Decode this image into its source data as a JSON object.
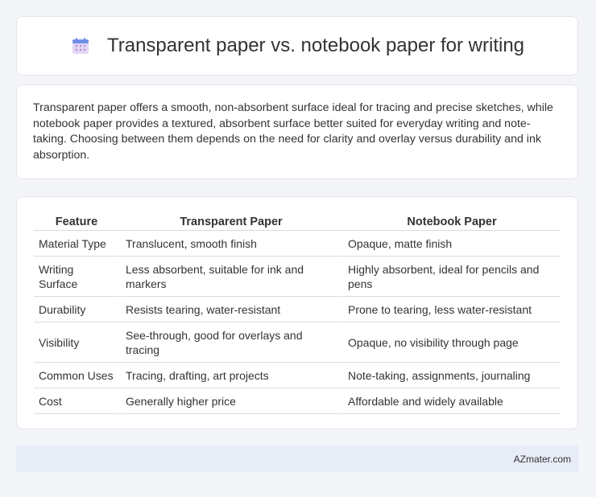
{
  "header": {
    "title": "Transparent paper vs. notebook paper for writing",
    "icon": "calendar-icon",
    "icon_colors": {
      "top": "#6f8fe6",
      "body": "#e3d6f3",
      "dots": "#a98bd8"
    }
  },
  "intro": {
    "text": "Transparent paper offers a smooth, non-absorbent surface ideal for tracing and precise sketches, while notebook paper provides a textured, absorbent surface better suited for everyday writing and note-taking. Choosing between them depends on the need for clarity and overlay versus durability and ink absorption."
  },
  "table": {
    "headers": [
      "Feature",
      "Transparent Paper",
      "Notebook Paper"
    ],
    "rows": [
      [
        "Material Type",
        "Translucent, smooth finish",
        "Opaque, matte finish"
      ],
      [
        "Writing Surface",
        "Less absorbent, suitable for ink and markers",
        "Highly absorbent, ideal for pencils and pens"
      ],
      [
        "Durability",
        "Resists tearing, water-resistant",
        "Prone to tearing, less water-resistant"
      ],
      [
        "Visibility",
        "See-through, good for overlays and tracing",
        "Opaque, no visibility through page"
      ],
      [
        "Common Uses",
        "Tracing, drafting, art projects",
        "Note-taking, assignments, journaling"
      ],
      [
        "Cost",
        "Generally higher price",
        "Affordable and widely available"
      ]
    ]
  },
  "footer": {
    "text": "AZmater.com"
  },
  "colors": {
    "background": "#f4f5f9",
    "card": "#ffffff",
    "footer_bg": "#e7ecf7",
    "row_divider": "#d9dbe2"
  }
}
